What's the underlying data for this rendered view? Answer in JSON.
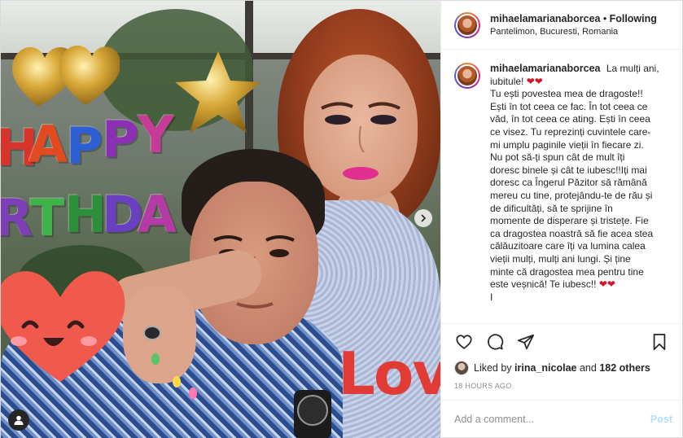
{
  "post": {
    "username": "mihaelamarianaborcea",
    "separator": "•",
    "follow_status": "Following",
    "location": "Pantelimon, Bucuresti, Romania"
  },
  "photo": {
    "balloon_letters": [
      "H",
      "A",
      "P",
      "P",
      "Y"
    ],
    "balloon_letters_row2": [
      "R",
      "T",
      "H",
      "D",
      "A"
    ],
    "overlay_text": "Lov"
  },
  "caption": {
    "username": "mihaelamarianaborcea",
    "lines": [
      "La mulți ani,",
      "iubitule! ❤❤",
      "Tu ești povestea mea de dragoste!!",
      "Ești în tot ceea ce fac. În tot ceea ce",
      "văd, în tot ceea ce ating. Ești în ceea",
      "ce visez. Tu reprezinți cuvintele care-",
      "mi umplu paginile vieții în fiecare zi.",
      "Nu pot să-ți spun cât de mult îți",
      "doresc binele și cât te iubesc!!Iți mai",
      "doresc ca Îngerul Păzitor să rămână",
      "mereu cu tine, protejându-te de rău și",
      "de dificultăți, să te sprijine în",
      "momente de disperare și tristețe. Fie",
      "ca dragostea noastră să fie acea stea",
      "călăuzitoare care îți va lumina calea",
      "vieții mulți, mulți ani lungi. Și ține",
      "minte că dragostea mea pentru tine",
      "este veșnică! Te iubesc!! ❤❤",
      "I"
    ]
  },
  "likes": {
    "prefix": "Liked by",
    "user": "irina_nicolae",
    "conjunction": "and",
    "others": "182 others"
  },
  "timestamp": "18 HOURS AGO",
  "comment": {
    "placeholder": "Add a comment...",
    "post_label": "Post"
  },
  "colors": {
    "accent_link": "#0095f6",
    "post_disabled": "#b2dffc",
    "secondary_text": "#8e8e8e",
    "heart_emoji": "#d3152c"
  },
  "icons": {
    "like": "heart-outline-icon",
    "comment": "speech-bubble-icon",
    "share": "paper-plane-icon",
    "save": "bookmark-icon",
    "tag": "user-tag-icon"
  }
}
